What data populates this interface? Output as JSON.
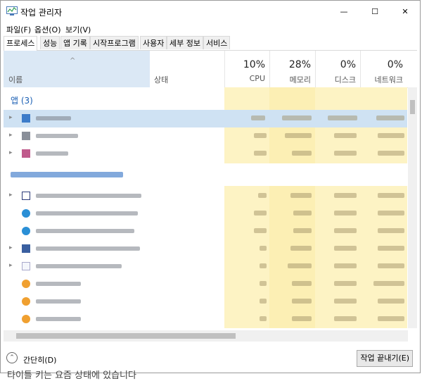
{
  "window": {
    "title": "작업 관리자",
    "controls": [
      "—",
      "☐",
      "✕"
    ]
  },
  "menu": [
    "파일(F)",
    "옵션(O)",
    "보기(V)"
  ],
  "tabs": [
    "프로세스",
    "성능",
    "앱 기록",
    "시작프로그램",
    "사용자",
    "세부 정보",
    "서비스"
  ],
  "header": {
    "name_label": "이름",
    "sort_glyph": "^",
    "status_label": "상태",
    "columns": [
      {
        "pct": "10%",
        "label": "CPU"
      },
      {
        "pct": "28%",
        "label": "메모리"
      },
      {
        "pct": "0%",
        "label": "디스크"
      },
      {
        "pct": "0%",
        "label": "네트워크"
      }
    ]
  },
  "groups": {
    "apps": "앱 (3)"
  },
  "footer": {
    "collapse_label": "간단히(D)",
    "end_task_label": "작업 끝내기(E)"
  },
  "bottom_text": "타이틀 키는 요즘 상태에 있습니다"
}
